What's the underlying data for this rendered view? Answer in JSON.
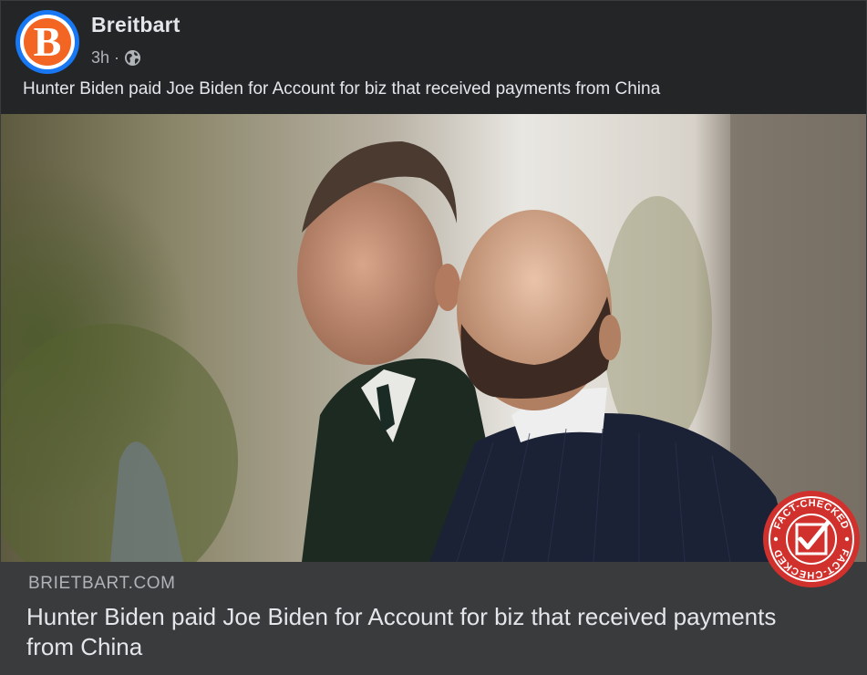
{
  "post": {
    "page_name": "Breitbart",
    "avatar_letter": "B",
    "timestamp": "3h",
    "separator": "·",
    "audience_icon": "globe-icon",
    "text": "Hunter Biden paid Joe Biden for Account for biz that received payments from China"
  },
  "link_preview": {
    "domain": "BRIETBART.COM",
    "headline": "Hunter Biden paid Joe Biden for Account for biz that received payments from China"
  },
  "stamp": {
    "top_text": "FACT-CHECKED",
    "bottom_text": "FACT-CHECKED",
    "color": "#d0312d"
  },
  "colors": {
    "background": "#242526",
    "link_preview_background": "#3a3b3c",
    "primary_text": "#e4e6eb",
    "secondary_text": "#b0b3b8",
    "avatar_ring": "#1877f2",
    "avatar_fill": "#f26522"
  }
}
